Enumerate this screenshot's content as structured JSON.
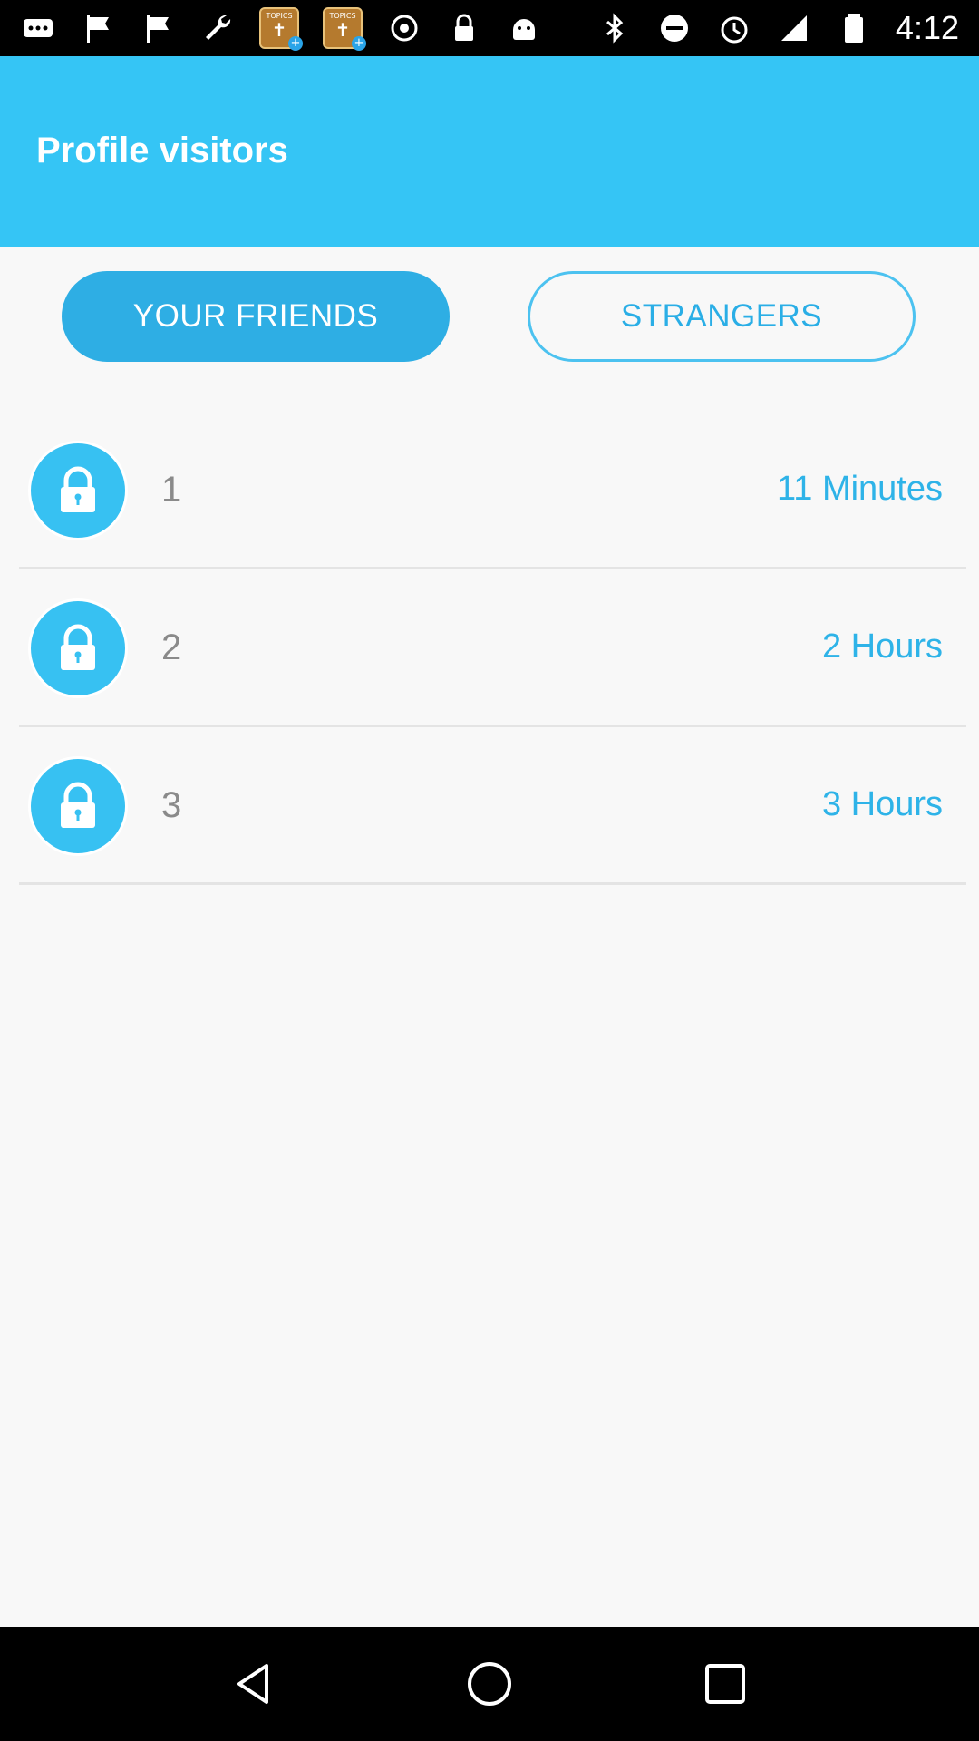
{
  "status_bar": {
    "time": "4:12",
    "topics_label": "TOPICS",
    "left_icons": [
      "more-icon",
      "flag-icon",
      "flag-icon",
      "wrench-icon",
      "topics-app-icon",
      "topics-app-icon",
      "dot-circle-icon",
      "lock-icon",
      "android-icon"
    ],
    "right_icons": [
      "bluetooth-icon",
      "do-not-disturb-icon",
      "alarm-icon",
      "signal-icon",
      "battery-icon"
    ]
  },
  "header": {
    "title": "Profile visitors",
    "color": "#35c5f5"
  },
  "tabs": [
    {
      "label": "YOUR FRIENDS",
      "selected": true
    },
    {
      "label": "STRANGERS",
      "selected": false
    }
  ],
  "visitors": [
    {
      "name": "1",
      "time": "11 Minutes",
      "icon": "lock-icon"
    },
    {
      "name": "2",
      "time": "2 Hours",
      "icon": "lock-icon"
    },
    {
      "name": "3",
      "time": "3 Hours",
      "icon": "lock-icon"
    }
  ],
  "nav_bar": {
    "buttons": [
      "back-icon",
      "home-icon",
      "recents-icon"
    ]
  },
  "colors": {
    "accent": "#35c5f5",
    "tab_active": "#2eaee4",
    "time_text": "#2eb3e8",
    "background": "#f8f8f8"
  }
}
